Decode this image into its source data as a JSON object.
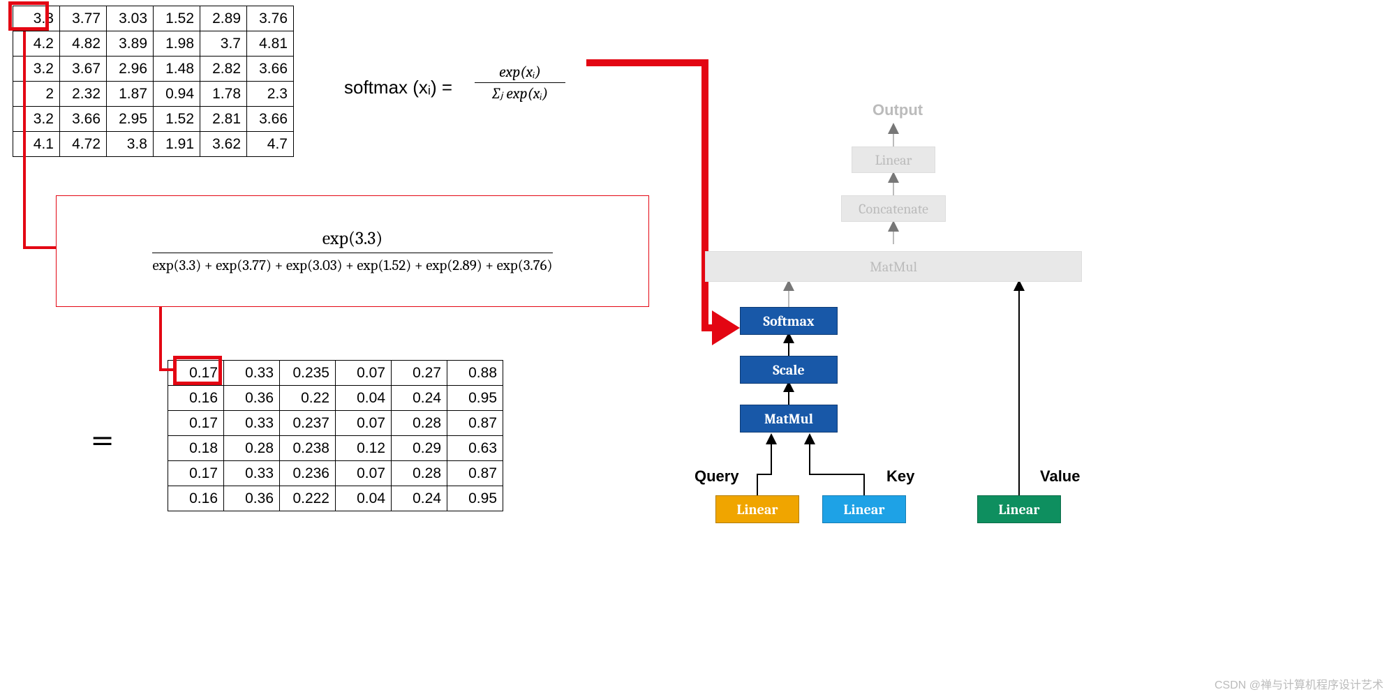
{
  "chart_data": {
    "type": "table",
    "diagram": "softmax calculation in scaled dot-product attention",
    "input_matrix": [
      [
        3.3,
        3.77,
        3.03,
        1.52,
        2.89,
        3.76
      ],
      [
        4.2,
        4.82,
        3.89,
        1.98,
        3.7,
        4.81
      ],
      [
        3.2,
        3.67,
        2.96,
        1.48,
        2.82,
        3.66
      ],
      [
        2,
        2.32,
        1.87,
        0.94,
        1.78,
        2.3
      ],
      [
        3.2,
        3.66,
        2.95,
        1.52,
        2.81,
        3.66
      ],
      [
        4.1,
        4.72,
        3.8,
        1.91,
        3.62,
        4.7
      ]
    ],
    "output_matrix": [
      [
        0.17,
        0.33,
        0.235,
        0.07,
        0.27,
        0.88
      ],
      [
        0.16,
        0.36,
        0.22,
        0.04,
        0.24,
        0.95
      ],
      [
        0.17,
        0.33,
        0.237,
        0.07,
        0.28,
        0.87
      ],
      [
        0.18,
        0.28,
        0.238,
        0.12,
        0.29,
        0.63
      ],
      [
        0.17,
        0.33,
        0.236,
        0.07,
        0.28,
        0.87
      ],
      [
        0.16,
        0.36,
        0.222,
        0.04,
        0.24,
        0.95
      ]
    ]
  },
  "input_table": [
    [
      "3.3",
      "3.77",
      "3.03",
      "1.52",
      "2.89",
      "3.76"
    ],
    [
      "4.2",
      "4.82",
      "3.89",
      "1.98",
      "3.7",
      "4.81"
    ],
    [
      "3.2",
      "3.67",
      "2.96",
      "1.48",
      "2.82",
      "3.66"
    ],
    [
      "2",
      "2.32",
      "1.87",
      "0.94",
      "1.78",
      "2.3"
    ],
    [
      "3.2",
      "3.66",
      "2.95",
      "1.52",
      "2.81",
      "3.66"
    ],
    [
      "4.1",
      "4.72",
      "3.8",
      "1.91",
      "3.62",
      "4.7"
    ]
  ],
  "output_table": [
    [
      "0.17",
      "0.33",
      "0.235",
      "0.07",
      "0.27",
      "0.88"
    ],
    [
      "0.16",
      "0.36",
      "0.22",
      "0.04",
      "0.24",
      "0.95"
    ],
    [
      "0.17",
      "0.33",
      "0.237",
      "0.07",
      "0.28",
      "0.87"
    ],
    [
      "0.18",
      "0.28",
      "0.238",
      "0.12",
      "0.29",
      "0.63"
    ],
    [
      "0.17",
      "0.33",
      "0.236",
      "0.07",
      "0.28",
      "0.87"
    ],
    [
      "0.16",
      "0.36",
      "0.222",
      "0.04",
      "0.24",
      "0.95"
    ]
  ],
  "softmax_formula": {
    "lhs": "softmax (xᵢ) =",
    "numer": "exp(xᵢ)",
    "denom": "∑ⱼ exp(xᵢ)"
  },
  "detail_formula": {
    "numer": "exp(3.3)",
    "denom": "exp(3.3) + exp(3.77) + exp(3.03) + exp(1.52) + exp(2.89) + exp(3.76)"
  },
  "equals": "=",
  "arch": {
    "output": "Output",
    "linear_top": "Linear",
    "concat": "Concatenate",
    "matmul_top": "MatMul",
    "softmax": "Softmax",
    "scale": "Scale",
    "matmul_bot": "MatMul",
    "query": "Query",
    "key": "Key",
    "value": "Value",
    "linear_q": "Linear",
    "linear_k": "Linear",
    "linear_v": "Linear"
  },
  "watermark": "CSDN @禅与计算机程序设计艺术"
}
